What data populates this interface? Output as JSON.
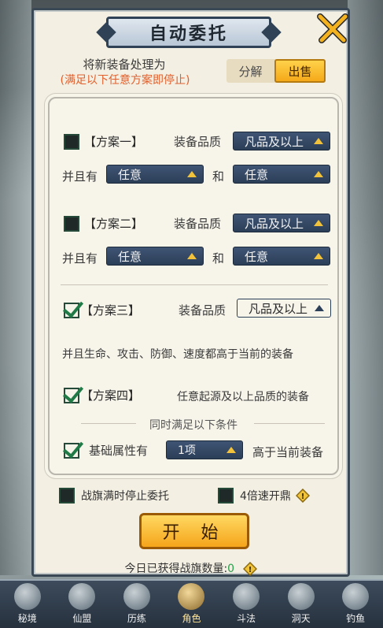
{
  "dialog": {
    "title": "自动委托",
    "header_label": "将新装备处理为",
    "header_sub": "(满足以下任意方案即停止)",
    "toggle": {
      "option1": "分解",
      "option2": "出售",
      "active": "出售"
    }
  },
  "plans": [
    {
      "checked": false,
      "label": "【方案一】",
      "quality_label": "装备品质",
      "quality_value": "凡品及以上",
      "and_label": "并且有",
      "attr1": "任意",
      "joiner": "和",
      "attr2": "任意"
    },
    {
      "checked": false,
      "label": "【方案二】",
      "quality_label": "装备品质",
      "quality_value": "凡品及以上",
      "and_label": "并且有",
      "attr1": "任意",
      "joiner": "和",
      "attr2": "任意"
    },
    {
      "checked": true,
      "label": "【方案三】",
      "quality_label": "装备品质",
      "quality_value": "凡品及以上",
      "description": "并且生命、攻击、防御、速度都高于当前的装备"
    },
    {
      "checked": true,
      "label": "【方案四】",
      "description": "任意起源及以上品质的装备"
    }
  ],
  "conditions": {
    "title": "同时满足以下条件",
    "base_attr": {
      "checked": true,
      "label": "基础属性有",
      "value": "1项",
      "suffix": "高于当前装备"
    }
  },
  "options": {
    "stop_on_full": {
      "checked": false,
      "label": "战旗满时停止委托"
    },
    "speed4x": {
      "checked": false,
      "label": "4倍速开鼎"
    }
  },
  "start_button": "开 始",
  "daily": {
    "label": "今日已获得战旗数量:",
    "value": "0"
  },
  "navbar": [
    {
      "label": "秘境"
    },
    {
      "label": "仙盟"
    },
    {
      "label": "历练"
    },
    {
      "label": "角色",
      "active": true
    },
    {
      "label": "斗法"
    },
    {
      "label": "洞天"
    },
    {
      "label": "钓鱼"
    }
  ],
  "colors": {
    "accent_orange": "#f5a91a",
    "warning_text": "#e2602c",
    "dropdown_bg": "#2c3f58",
    "check_green": "#1f7a46",
    "daily_count": "#27a04a"
  },
  "icons": {
    "close": "crossed-swords-icon",
    "warning": "warning-diamond-icon"
  }
}
